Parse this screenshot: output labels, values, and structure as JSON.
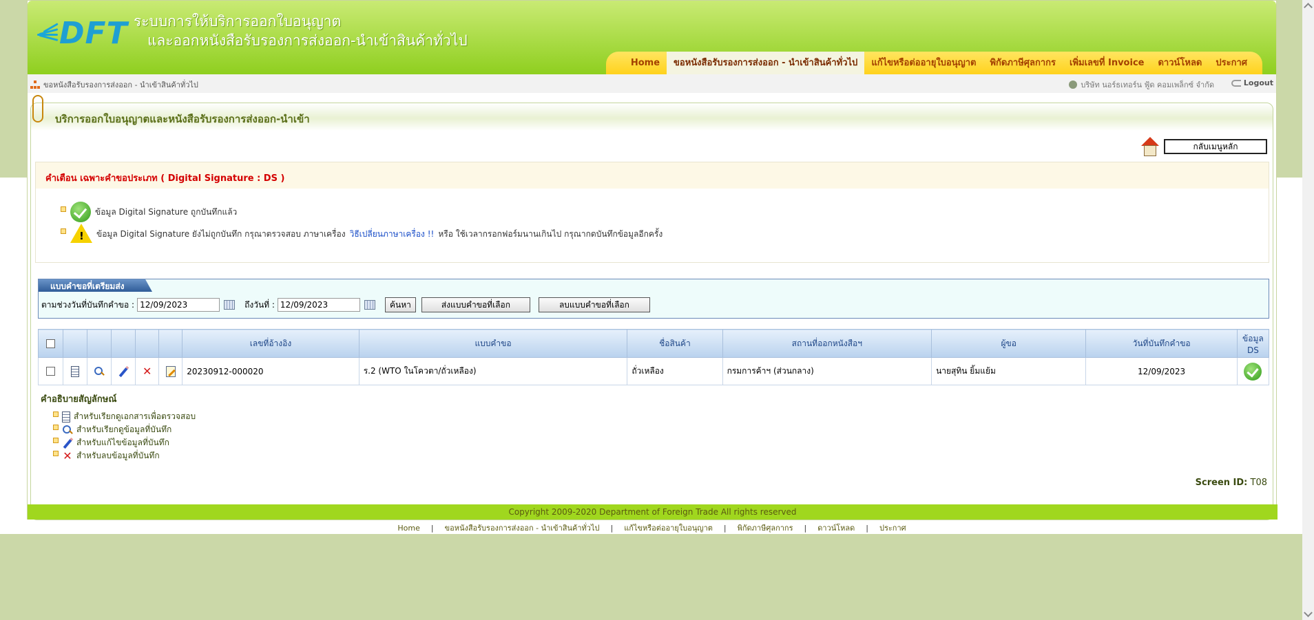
{
  "header": {
    "logo_text": "DFT",
    "title_line1": "ระบบการให้บริการออกใบอนุญาต",
    "title_line2": "และออกหนังสือรับรองการส่งออก-นำเข้าสินค้าทั่วไป"
  },
  "nav": [
    {
      "label": "Home",
      "active": false
    },
    {
      "label": "ขอหนังสือรับรองการส่งออก - นำเข้าสินค้าทั่วไป",
      "active": true
    },
    {
      "label": "แก้ไขหรือต่ออายุใบอนุญาต",
      "active": false
    },
    {
      "label": "พิกัดภาษีศุลกากร",
      "active": false
    },
    {
      "label": "เพิ่มเลขที่ Invoice",
      "active": false
    },
    {
      "label": "ดาวน์โหลด",
      "active": false
    },
    {
      "label": "ประกาศ",
      "active": false
    }
  ],
  "breadcrumb": "ขอหนังสือรับรองการส่งออก - นำเข้าสินค้าทั่วไป",
  "user": "บริษัท นอร์ธเทอร์น ฟู้ด คอมเพล็กซ์ จำกัด",
  "logout_label": "Logout",
  "panel_title": "บริการออกใบอนุญาตและหนังสือรับรองการส่งออก-นำเข้า",
  "back_button": "กลับเมนูหลัก",
  "warning": {
    "title": "คำเตือน เฉพาะคำขอประเภท ( Digital Signature : DS )",
    "ok_text": "ข้อมูล Digital Signature ถูกบันทึกแล้ว",
    "warn_text_before": "ข้อมูล Digital Signature ยังไม่ถูกบันทึก กรุณาตรวจสอบ ภาษาเครื่อง",
    "warn_link": "วิธีเปลี่ยนภาษาเครื่อง !!",
    "warn_text_after": "หรือ ใช้เวลากรอกฟอร์มนานเกินไป กรุณากดบันทึกข้อมูลอีกครั้ง"
  },
  "form": {
    "tab_label": "แบบคำขอที่เตรียมส่ง",
    "from_label": "ตามช่วงวันที่บันทึกคำขอ :",
    "from_value": "12/09/2023",
    "to_label": "ถึงวันที่ :",
    "to_value": "12/09/2023",
    "search_button": "ค้นหา",
    "send_button": "ส่งแบบคำขอที่เลือก",
    "delete_button": "ลบแบบคำขอที่เลือก"
  },
  "table": {
    "headers": [
      "เลขที่อ้างอิง",
      "แบบคำขอ",
      "ชื่อสินค้า",
      "สถานที่ออกหนังสือฯ",
      "ผู้ขอ",
      "วันที่บันทึกคำขอ",
      "ข้อมูล DS"
    ],
    "rows": [
      {
        "ref": "20230912-000020",
        "form": "ร.2 (WTO ในโควตา/ถั่วเหลือง)",
        "product": "ถั่วเหลือง",
        "office": "กรมการค้าฯ (ส่วนกลาง)",
        "requester": "นายสุทิน ยิ้มแย้ม",
        "date": "12/09/2023"
      }
    ]
  },
  "legend": {
    "title": "คำอธิบายสัญลักษณ์",
    "items": [
      {
        "icon": "document-icon",
        "label": "สำหรับเรียกดูเอกสารเพื่อตรวจสอบ"
      },
      {
        "icon": "magnifier-icon",
        "label": "สำหรับเรียกดูข้อมูลที่บันทึก"
      },
      {
        "icon": "pencil-icon",
        "label": "สำหรับแก้ไขข้อมูลที่บันทึก"
      },
      {
        "icon": "delete-x-icon",
        "label": "สำหรับลบข้อมูลที่บันทึก"
      }
    ]
  },
  "screen_id_label": "Screen ID:",
  "screen_id": "T08",
  "copyright": "Copyright 2009-2020 Department of Foreign Trade All rights reserved",
  "footer_links": [
    "Home",
    "ขอหนังสือรับรองการส่งออก - นำเข้าสินค้าทั่วไป",
    "แก้ไขหรือต่ออายุใบอนุญาต",
    "พิกัดภาษีศุลกากร",
    "ดาวน์โหลด",
    "ประกาศ"
  ],
  "colors": {
    "header_green": "#8fcf1f",
    "nav_yellow": "#ffd21d",
    "warning_red": "#d40000",
    "table_header": "#b9d2ee"
  }
}
